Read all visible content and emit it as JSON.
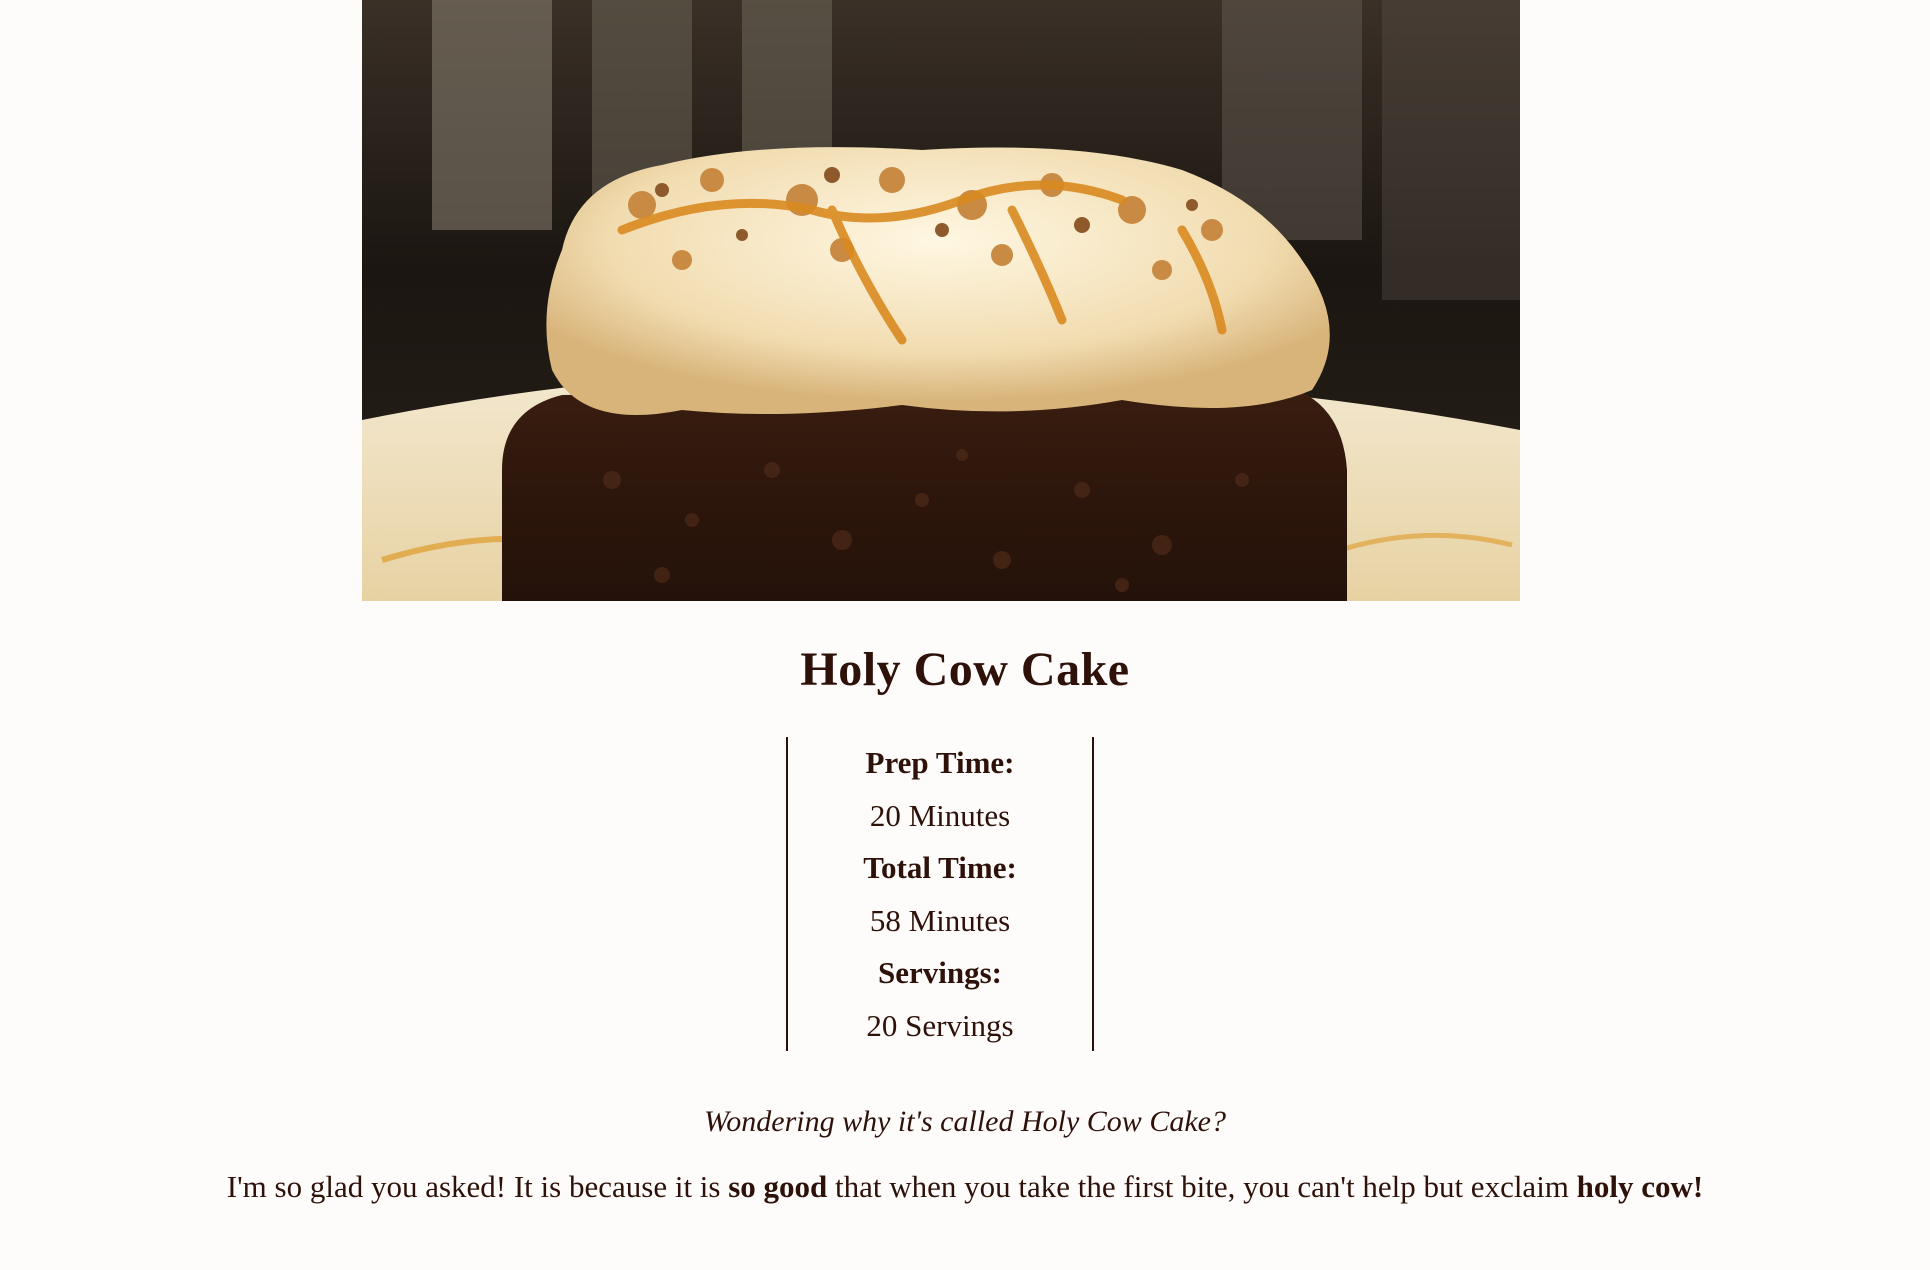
{
  "recipe": {
    "image_alt": "Holy Cow Cake",
    "title": "Holy Cow Cake",
    "meta": {
      "prep_label": "Prep Time:",
      "prep_value": "20 Minutes",
      "total_label": "Total Time:",
      "total_value": "58 Minutes",
      "servings_label": "Servings:",
      "servings_value": "20 Servings"
    },
    "intro": {
      "question": "Wondering why it's called Holy Cow Cake?",
      "answer_part1": "I'm so glad you asked! It is because it is ",
      "answer_bold1": "so good",
      "answer_part2": " that when you take the first bite, you can't help but exclaim ",
      "answer_bold2": "holy cow!"
    }
  },
  "colors": {
    "text": "#2e120a",
    "background": "#fefcfb"
  }
}
